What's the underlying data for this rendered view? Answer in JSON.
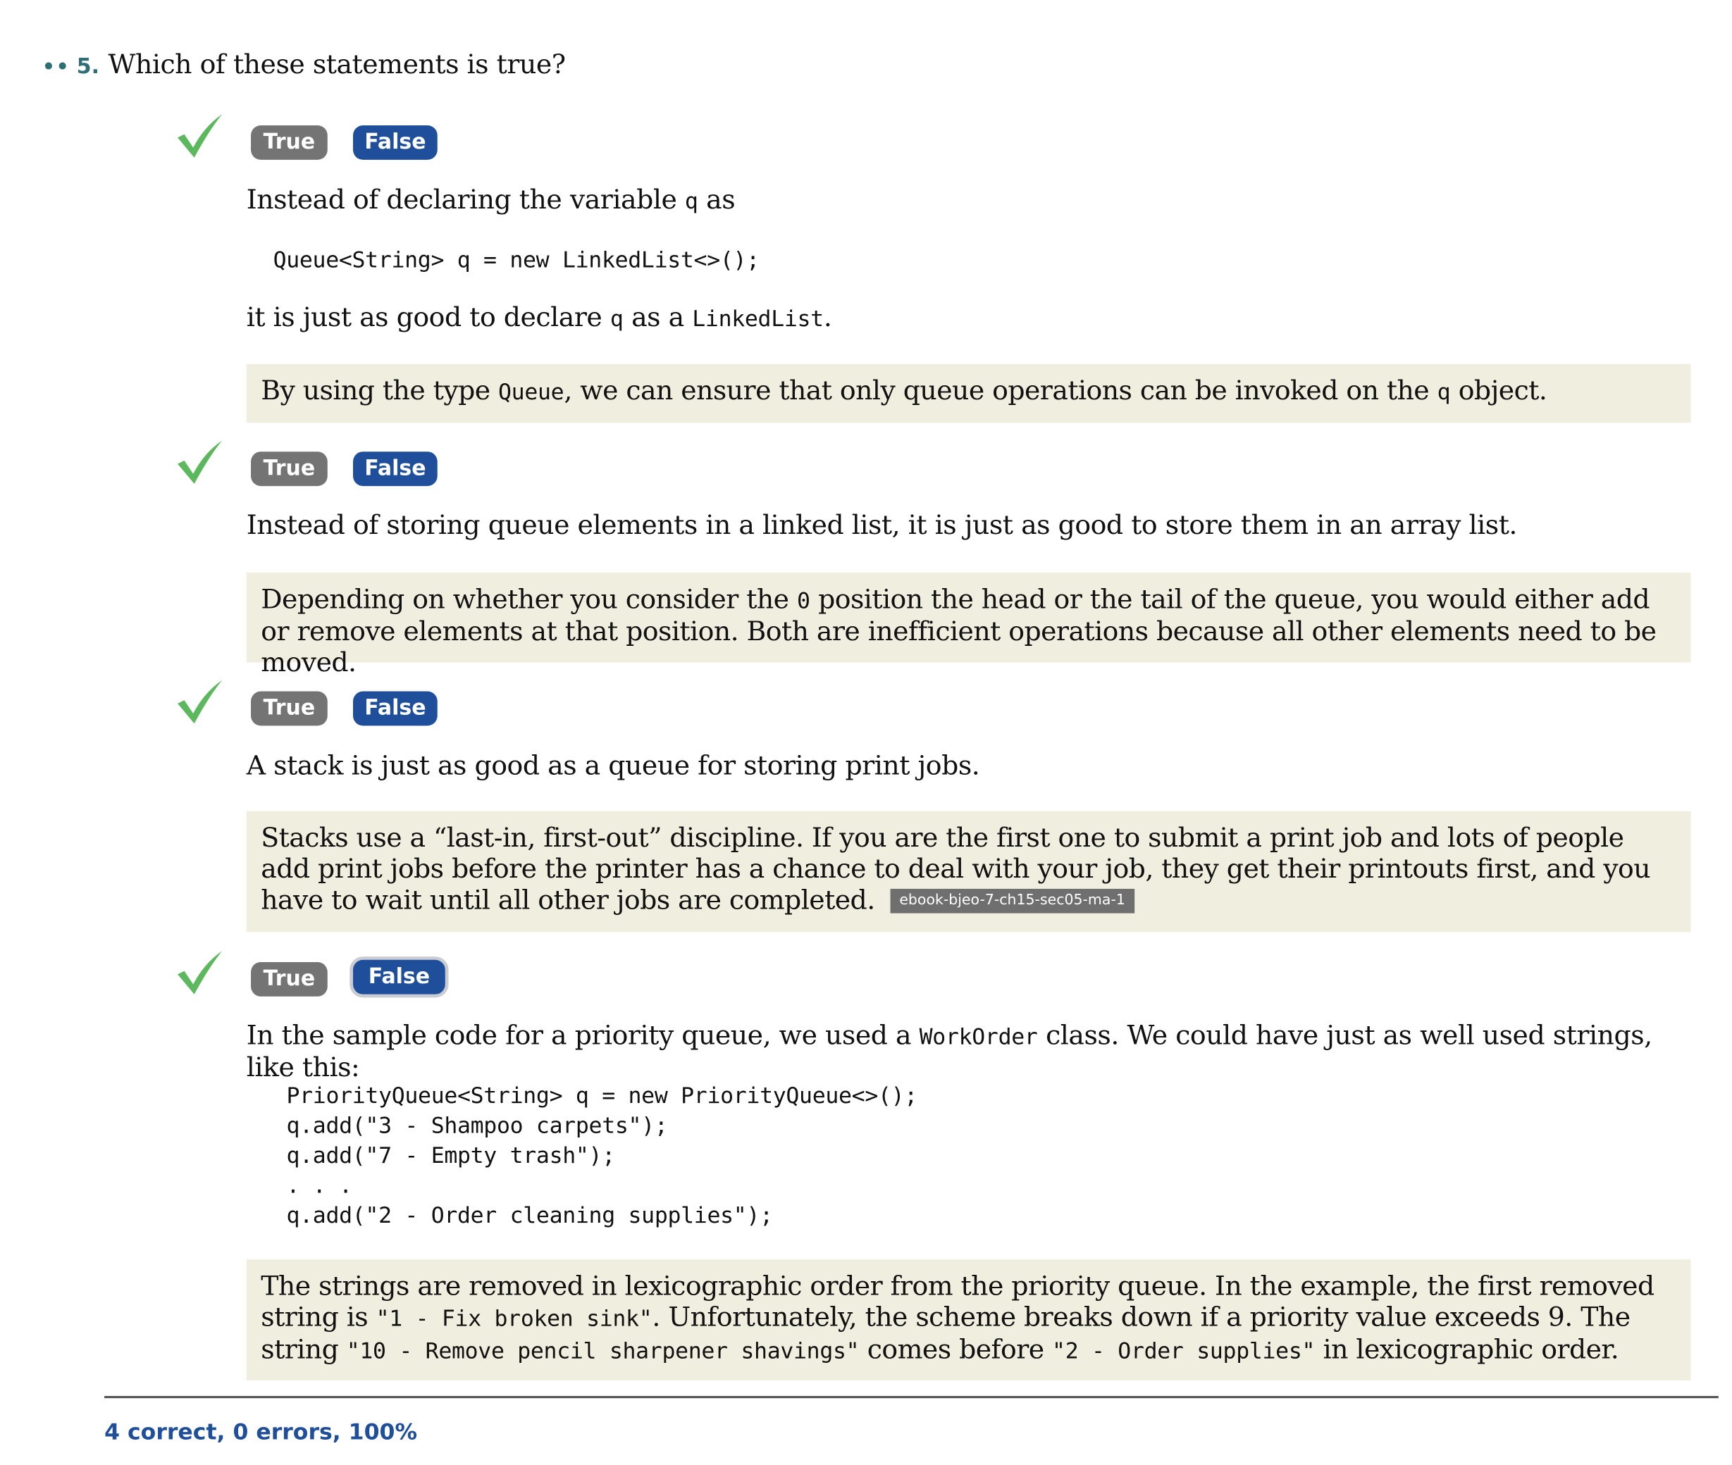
{
  "question": {
    "dots": "••",
    "number": "5.",
    "text": "Which of these statements is true?"
  },
  "buttons": {
    "true_label": "True",
    "false_label": "False"
  },
  "items": [
    {
      "result": "correct",
      "stmt_a": "Instead of declaring the variable ",
      "stmt_a_code": "q",
      "stmt_a_end": " as",
      "code": "Queue<String> q = new LinkedList<>();",
      "stmt_b": "it is just as good to declare ",
      "stmt_b_code1": "q",
      "stmt_b_mid": " as a ",
      "stmt_b_code2": "LinkedList",
      "stmt_b_end": ".",
      "fb_a": "By using the type ",
      "fb_code1": "Queue",
      "fb_b": ", we can ensure that only queue operations can be invoked on the ",
      "fb_code2": "q",
      "fb_c": " object."
    },
    {
      "result": "correct",
      "stmt": "Instead of storing queue elements in a linked list, it is just as good to store them in an array list.",
      "fb_a": "Depending on whether you consider the ",
      "fb_code1": "0",
      "fb_b": " position the head or the tail of the queue, you would either add or remove elements at that position. Both are inefficient operations because all other elements need to be moved."
    },
    {
      "result": "correct",
      "stmt": "A stack is just as good as a queue for storing print jobs.",
      "fb": "Stacks use a “last-in, first-out” discipline. If you are the first one to submit a print job and lots of people add print jobs before the printer has a chance to deal with your job, they get their printouts first, and you have to wait until all other jobs are completed.",
      "tag": "ebook-bjeo-7-ch15-sec05-ma-1"
    },
    {
      "result": "correct",
      "selected": "False",
      "stmt_a": "In the sample code for a priority queue, we used a ",
      "stmt_code": "WorkOrder",
      "stmt_b": " class. We could have just as well used strings, like this:",
      "code": [
        "PriorityQueue<String> q = new PriorityQueue<>();",
        "q.add(\"3 - Shampoo carpets\");",
        "q.add(\"7 - Empty trash\");",
        ". . .",
        "q.add(\"2 - Order cleaning supplies\");"
      ],
      "fb_a": "The strings are removed in lexicographic order from the priority queue. In the example, the first removed string is ",
      "fb_code1": "\"1 - Fix broken sink\"",
      "fb_b": ". Unfortunately, the scheme breaks down if a priority value exceeds 9. The string ",
      "fb_code2": "\"10 - Remove pencil sharpener shavings\"",
      "fb_c": " comes before ",
      "fb_code3": "\"2 - Order supplies\"",
      "fb_d": " in lexicographic order."
    }
  ],
  "score": "4 correct, 0 errors, 100%",
  "colors": {
    "check": "#5cb85c",
    "true_button": "#747474",
    "false_button": "#1f4f9b",
    "feedback_bg": "#f0eede",
    "header_accent": "#2e6e74",
    "score": "#1f4f9b"
  }
}
